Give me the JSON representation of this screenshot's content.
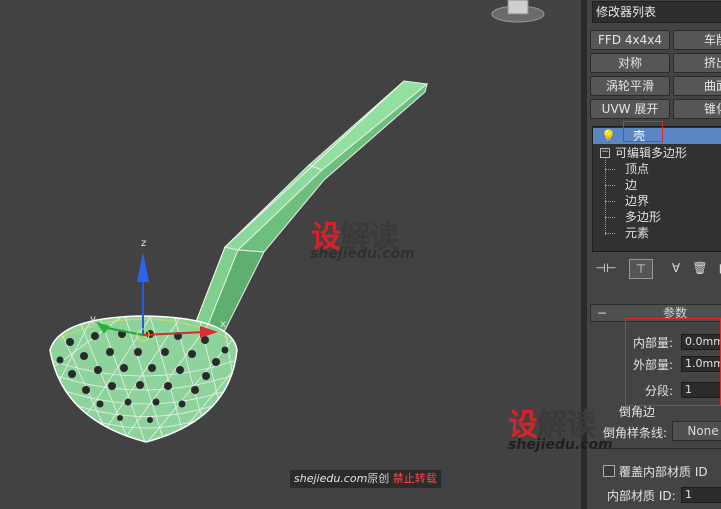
{
  "watermark": {
    "logo_red": "设",
    "logo_dark": "解读",
    "url": "shejiedu.com"
  },
  "credit": {
    "site": "shejiedu.com",
    "original": "原创",
    "ban": "禁止转载"
  },
  "viewport": {
    "axis_x": "x",
    "axis_y": "y",
    "axis_z": "z"
  },
  "modifier_list": {
    "title": "修改器列表",
    "buttons": [
      {
        "label": "FFD 4x4x4"
      },
      {
        "label": "车削"
      },
      {
        "label": "对称"
      },
      {
        "label": "挤出"
      },
      {
        "label": "涡轮平滑"
      },
      {
        "label": "曲面"
      },
      {
        "label": "UVW 展开"
      },
      {
        "label": "锥化"
      }
    ]
  },
  "stack": {
    "shell": "壳",
    "editable_poly": "可编辑多边形",
    "subobjects": [
      "顶点",
      "边",
      "边界",
      "多边形",
      "元素"
    ]
  },
  "parameters": {
    "title": "参数",
    "inner_amount_label": "内部量:",
    "inner_amount_value": "0.0mm",
    "outer_amount_label": "外部量:",
    "outer_amount_value": "1.0mm",
    "segments_label": "分段:",
    "segments_value": "1",
    "bevel_edges_label": "倒角边",
    "bevel_spline_label": "倒角样条线:",
    "bevel_spline_value": "None",
    "override_inner_mat_label": "覆盖内部材质 ID",
    "inner_mat_id_label": "内部材质 ID:",
    "inner_mat_id_value": "1"
  }
}
